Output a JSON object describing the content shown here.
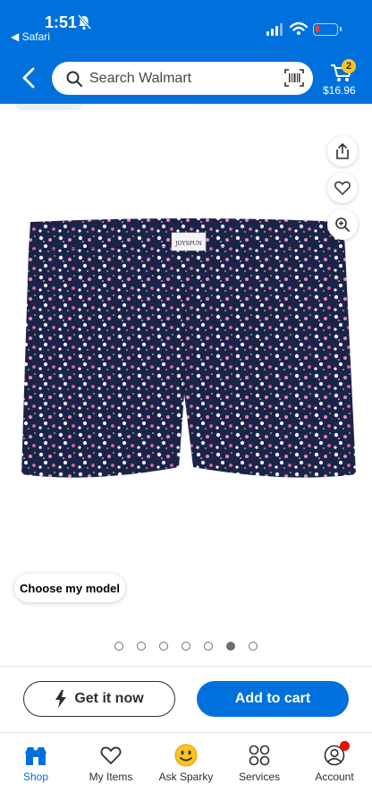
{
  "status_bar": {
    "time": "1:51",
    "back_app": "◀ Safari"
  },
  "header": {
    "search_placeholder": "Search Walmart",
    "cart_count": "2",
    "cart_total": "$16.96"
  },
  "product": {
    "label_text": "JOYSPUN",
    "choose_model_label": "Choose my model",
    "image_count": 7,
    "active_image_index": 5
  },
  "actions": {
    "get_it_now": "Get it now",
    "add_to_cart": "Add to cart"
  },
  "tabs": [
    {
      "label": "Shop",
      "icon": "shop-icon"
    },
    {
      "label": "My Items",
      "icon": "heart-icon"
    },
    {
      "label": "Ask Sparky",
      "icon": "sparky-icon"
    },
    {
      "label": "Services",
      "icon": "services-icon"
    },
    {
      "label": "Account",
      "icon": "account-icon"
    }
  ],
  "colors": {
    "brand_blue": "#0071dc",
    "spark_yellow": "#ffc220",
    "notification_red": "#ea1100",
    "shorts_navy": "#1c2348"
  }
}
